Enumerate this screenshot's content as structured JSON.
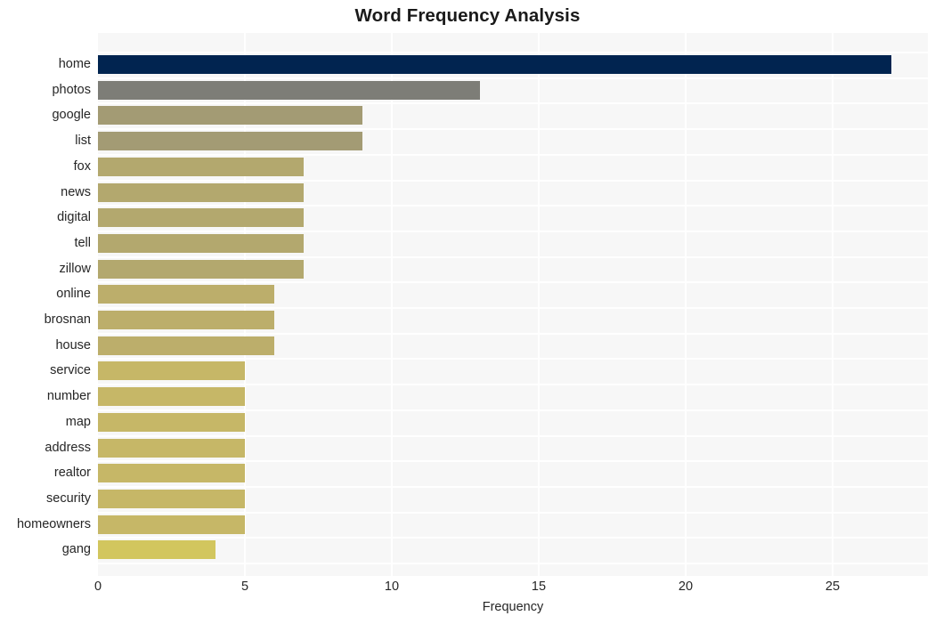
{
  "chart_data": {
    "type": "bar",
    "orientation": "horizontal",
    "title": "Word Frequency Analysis",
    "xlabel": "Frequency",
    "ylabel": "",
    "xlim": [
      0,
      27
    ],
    "xticks": [
      0,
      5,
      10,
      15,
      20,
      25
    ],
    "xtick_labels": [
      "0",
      "5",
      "10",
      "15",
      "20",
      "25"
    ],
    "grid": true,
    "grid_color": "#ffffff",
    "plot_background": "#f7f7f7",
    "legend": null,
    "categories": [
      "home",
      "photos",
      "google",
      "list",
      "fox",
      "news",
      "digital",
      "tell",
      "zillow",
      "online",
      "brosnan",
      "house",
      "service",
      "number",
      "map",
      "address",
      "realtor",
      "security",
      "homeowners",
      "gang"
    ],
    "values": [
      27,
      13,
      9,
      9,
      7,
      7,
      7,
      7,
      7,
      6,
      6,
      6,
      5,
      5,
      5,
      5,
      5,
      5,
      5,
      4
    ],
    "bar_colors": [
      "#012450",
      "#7d7d77",
      "#a39b74",
      "#a39b74",
      "#b3a86e",
      "#b3a86e",
      "#b3a86e",
      "#b3a86e",
      "#b3a86e",
      "#bcae6b",
      "#bcae6b",
      "#bcae6b",
      "#c6b767",
      "#c6b767",
      "#c6b767",
      "#c6b767",
      "#c6b767",
      "#c6b767",
      "#c6b767",
      "#d2c65e"
    ]
  }
}
